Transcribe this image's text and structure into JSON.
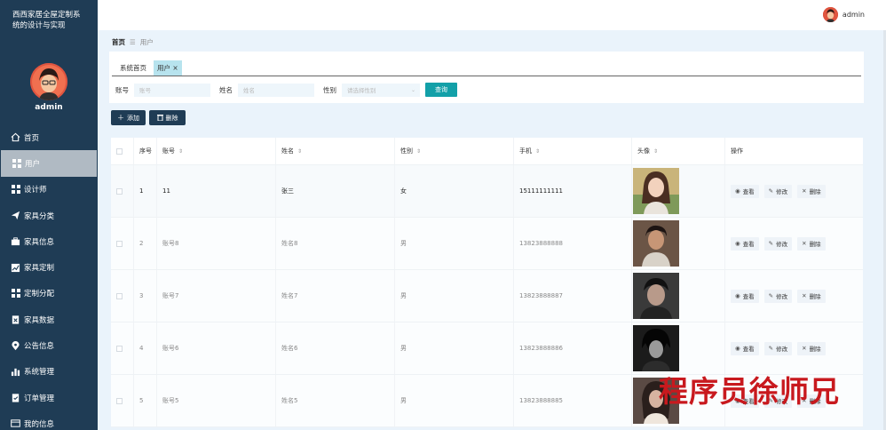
{
  "sidebar": {
    "title": "西西家居全屋定制系统的设计与实现",
    "username": "admin",
    "items": [
      {
        "label": "首页",
        "icon": "home-icon"
      },
      {
        "label": "用户",
        "icon": "grid-icon",
        "active": true
      },
      {
        "label": "设计师",
        "icon": "grid-icon"
      },
      {
        "label": "家具分类",
        "icon": "paper-plane-icon"
      },
      {
        "label": "家具信息",
        "icon": "briefcase-icon"
      },
      {
        "label": "家具定制",
        "icon": "chart-line-icon"
      },
      {
        "label": "定制分配",
        "icon": "grid-icon"
      },
      {
        "label": "家具数据",
        "icon": "clipboard-x-icon"
      },
      {
        "label": "公告信息",
        "icon": "location-pin-icon"
      },
      {
        "label": "系统管理",
        "icon": "bar-chart-icon"
      },
      {
        "label": "订单管理",
        "icon": "clipboard-check-icon"
      },
      {
        "label": "我的信息",
        "icon": "id-card-icon"
      }
    ]
  },
  "topbar": {
    "username": "admin"
  },
  "breadcrumb": {
    "home": "首页",
    "current": "用户"
  },
  "tabs": [
    {
      "label": "系统首页"
    },
    {
      "label": "用户",
      "close": "×",
      "active": true
    }
  ],
  "search": {
    "account_label": "账号",
    "account_placeholder": "账号",
    "name_label": "姓名",
    "name_placeholder": "姓名",
    "sex_label": "性别",
    "sex_placeholder": "请选择性别",
    "query_button": "查询"
  },
  "actions": {
    "add": "添加",
    "delete": "删除"
  },
  "table": {
    "headers": {
      "index": "序号",
      "account": "账号",
      "name": "姓名",
      "sex": "性别",
      "phone": "手机",
      "avatar": "头像",
      "ops": "操作"
    },
    "op_labels": {
      "view": "查看",
      "edit": "修改",
      "delete": "删除"
    },
    "rows": [
      {
        "index": "1",
        "account": "11",
        "name": "张三",
        "sex": "女",
        "phone": "15111111111"
      },
      {
        "index": "2",
        "account": "账号8",
        "name": "姓名8",
        "sex": "男",
        "phone": "13823888888"
      },
      {
        "index": "3",
        "account": "账号7",
        "name": "姓名7",
        "sex": "男",
        "phone": "13823888887"
      },
      {
        "index": "4",
        "account": "账号6",
        "name": "姓名6",
        "sex": "男",
        "phone": "13823888886"
      },
      {
        "index": "5",
        "account": "账号5",
        "name": "姓名5",
        "sex": "男",
        "phone": "13823888885"
      }
    ]
  },
  "watermark": "程序员徐师兄",
  "colors": {
    "sidebar": "#1f3c55",
    "accent": "#13a0a8",
    "watermark": "#c8191e"
  }
}
